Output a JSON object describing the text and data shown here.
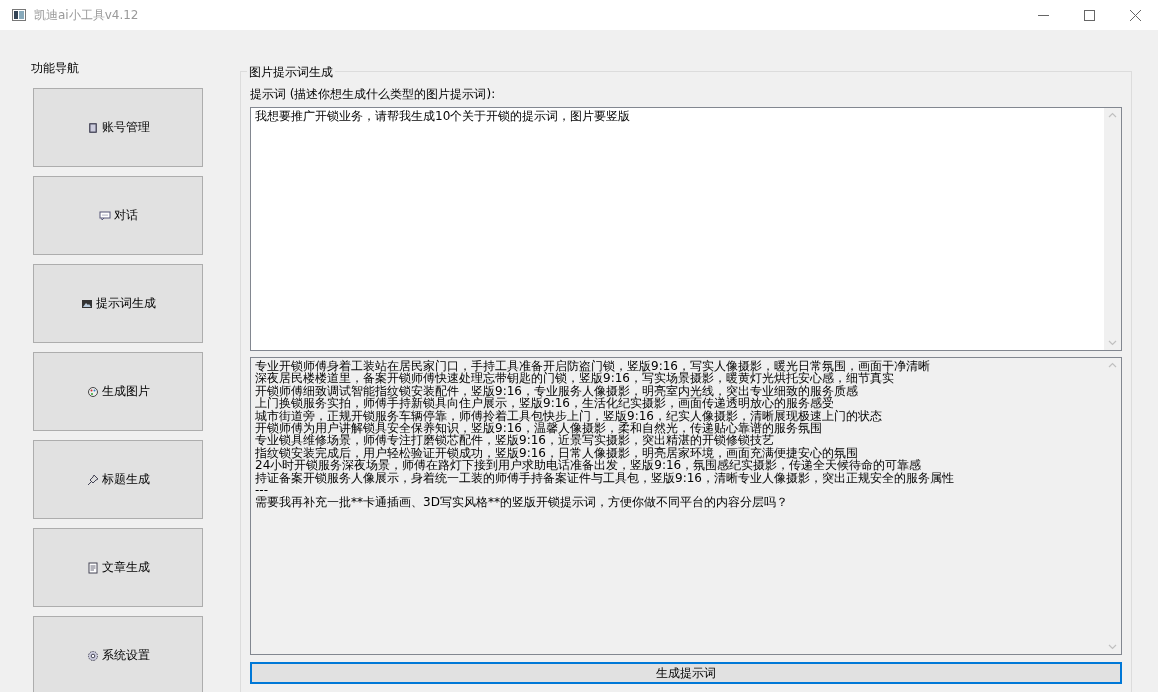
{
  "window": {
    "title": "凯迪ai小工具v4.12"
  },
  "nav": {
    "label": "功能导航",
    "items": [
      {
        "label": "账号管理"
      },
      {
        "label": "对话"
      },
      {
        "label": "提示词生成"
      },
      {
        "label": "生成图片"
      },
      {
        "label": "标题生成"
      },
      {
        "label": "文章生成"
      },
      {
        "label": "系统设置"
      }
    ]
  },
  "group": {
    "title": "图片提示词生成",
    "prompt_label": "提示词 (描述你想生成什么类型的图片提示词):",
    "prompt_value": "我想要推广开锁业务，请帮我生成10个关于开锁的提示词，图片要竖版",
    "output_lines": [
      "专业开锁师傅身着工装站在居民家门口，手持工具准备开启防盗门锁，竖版9:16，写实人像摄影，暖光日常氛围，画面干净清晰",
      "深夜居民楼楼道里，备案开锁师傅快速处理忘带钥匙的门锁，竖版9:16，写实场景摄影，暖黄灯光烘托安心感，细节真实",
      "开锁师傅细致调试智能指纹锁安装配件，竖版9:16，专业服务人像摄影，明亮室内光线，突出专业细致的服务质感",
      "上门换锁服务实拍，师傅手持新锁具向住户展示，竖版9:16，生活化纪实摄影，画面传递透明放心的服务感受",
      "城市街道旁，正规开锁服务车辆停靠，师傅拎着工具包快步上门，竖版9:16，纪实人像摄影，清晰展现极速上门的状态",
      "开锁师傅为用户讲解锁具安全保养知识，竖版9:16，温馨人像摄影，柔和自然光，传递贴心靠谱的服务氛围",
      "专业锁具维修场景，师傅专注打磨锁芯配件，竖版9:16，近景写实摄影，突出精湛的开锁修锁技艺",
      "指纹锁安装完成后，用户轻松验证开锁成功，竖版9:16，日常人像摄影，明亮居家环境，画面充满便捷安心的氛围",
      "24小时开锁服务深夜场景，师傅在路灯下接到用户求助电话准备出发，竖版9:16，氛围感纪实摄影，传递全天候待命的可靠感",
      "持证备案开锁服务人像展示，身着统一工装的师傅手持备案证件与工具包，竖版9:16，清晰专业人像摄影，突出正规安全的服务属性",
      "---",
      "需要我再补充一批**卡通插画、3D写实风格**的竖版开锁提示词，方便你做不同平台的内容分层吗？"
    ],
    "button": "生成提示词"
  }
}
